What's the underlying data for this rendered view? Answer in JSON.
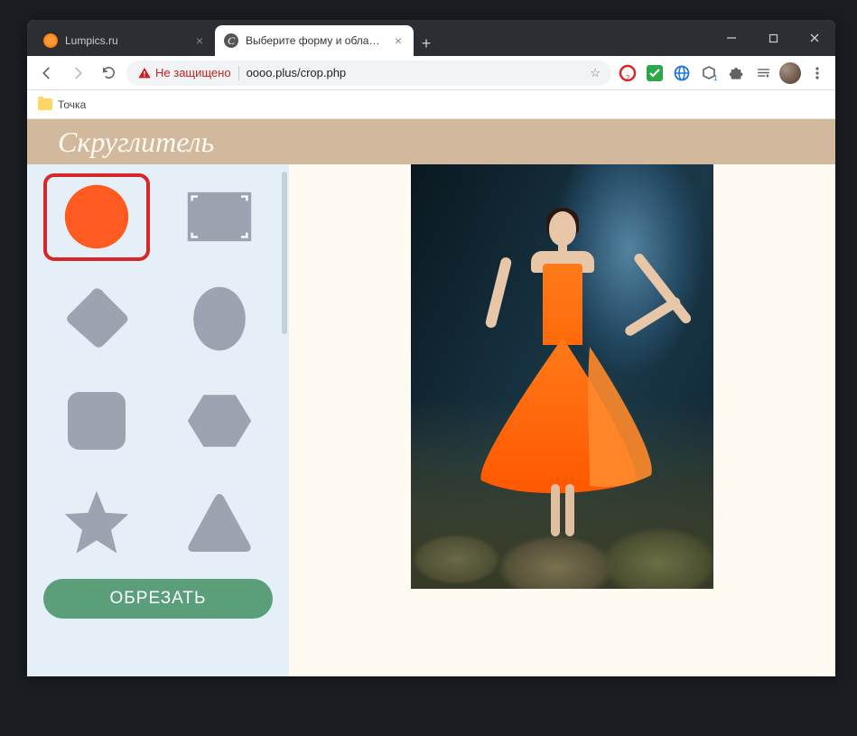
{
  "browser": {
    "tabs": [
      {
        "title": "Lumpics.ru",
        "active": false
      },
      {
        "title": "Выберите форму и область для",
        "active": true
      }
    ],
    "security_label": "Не защищено",
    "url": "oooo.plus/crop.php"
  },
  "bookmarks": {
    "item1": "Точка"
  },
  "page": {
    "brand": "Скруглитель",
    "crop_button": "ОБРЕЗАТЬ",
    "shapes": [
      {
        "id": "circle",
        "selected": true
      },
      {
        "id": "frame",
        "selected": false
      },
      {
        "id": "diamond",
        "selected": false
      },
      {
        "id": "ellipse",
        "selected": false
      },
      {
        "id": "rounded",
        "selected": false
      },
      {
        "id": "hexagon",
        "selected": false
      },
      {
        "id": "star",
        "selected": false
      },
      {
        "id": "triangle",
        "selected": false
      }
    ]
  }
}
